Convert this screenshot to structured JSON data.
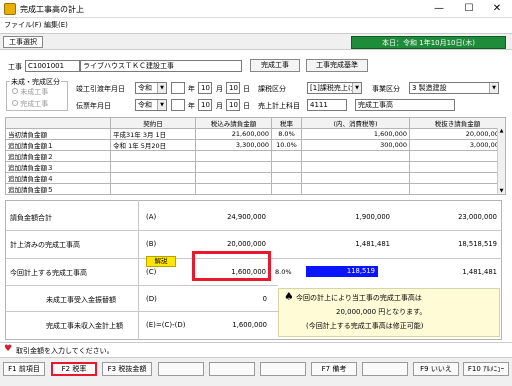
{
  "window": {
    "title": "完成工事高の計上",
    "min_glyph": "—",
    "max_glyph": "☐",
    "close_glyph": "✕"
  },
  "menu": {
    "file": "ファイル(F)",
    "edit": "編集(E)"
  },
  "toolbar": {
    "tab_label": "工事選択",
    "date_text": "本日：令和 1年10月10日(木)"
  },
  "form": {
    "koji_label": "工事",
    "koji_code": "C1001001",
    "koji_name": "ライブハウスＴＫＣ建設工事",
    "kanseikoji_btn": "完成工事",
    "kanseikoji_kijun_btn": "工事完成基準",
    "kubun_title": "未成・完成区分",
    "mikansei_label": "未成工事",
    "kansei_label": "完成工事",
    "kanseibi_label": "竣工引渡年月日",
    "era": "令和",
    "year": "",
    "year_unit": "年",
    "month": "10",
    "month_unit": "月",
    "day": "10",
    "day_unit": "日",
    "kazei_label": "課税区分",
    "kazei_value": "[1]課税売上げ",
    "jigyo_label": "事業区分",
    "jigyo_value": "3 製造建設",
    "denpyo_label": "伝票年月日",
    "era2": "令和",
    "year2": "",
    "month2": "10",
    "day2": "10",
    "uriage_label": "売上計上科目",
    "uriage_code": "4111",
    "uriage_name": "完成工事高"
  },
  "grid": {
    "headers": [
      "",
      "契約日",
      "税込み請負金額",
      "税率",
      "(内、消費税等)",
      "税抜き請負金額"
    ],
    "rows": [
      [
        "当初請負金額",
        "平成31年 3月 1日",
        "21,600,000",
        "8.0%",
        "1,600,000",
        "20,000,000"
      ],
      [
        "追加請負金額１",
        "令和 1年 5月20日",
        "3,300,000",
        "10.0%",
        "300,000",
        "3,000,000"
      ],
      [
        "追加請負金額２",
        "",
        "",
        "",
        "",
        ""
      ],
      [
        "追加請負金額３",
        "",
        "",
        "",
        "",
        ""
      ],
      [
        "追加請負金額４",
        "",
        "",
        "",
        "",
        ""
      ],
      [
        "追加請負金額５",
        "",
        "",
        "",
        "",
        ""
      ]
    ]
  },
  "summary": {
    "total_label": "請負金額合計",
    "total_key": "(A)",
    "total_incl": "24,900,000",
    "total_tax": "1,900,000",
    "total_excl": "23,000,000",
    "done_label": "計上済みの完成工事高",
    "done_key": "(B)",
    "done_incl": "20,000,000",
    "done_tax": "1,481,481",
    "done_excl": "18,518,519",
    "kaisetsu": "解説",
    "current_label": "今回計上する完成工事高",
    "current_key": "(C)",
    "current_incl": "1,600,000",
    "current_rate": "8.0%",
    "current_tax": "118,519",
    "current_excl": "1,481,481",
    "advance_label": "未成工事受入金振替額",
    "advance_key": "(D)",
    "advance_value": "0",
    "receivable_label": "完成工事未収入金計上額",
    "receivable_key": "(E)=(C)-(D)",
    "receivable_value": "1,600,000",
    "note_line1": "今回の計上により当工事の完成工事高は",
    "note_line2": "20,000,000 円となります。",
    "note_line3": "(今回計上する完成工事高は修正可能)",
    "note_icon": "♠"
  },
  "status": {
    "icon": "♥",
    "text": "取引金額を入力してください。"
  },
  "fkeys": [
    {
      "label": "F1 前項目"
    },
    {
      "label": "F2 税率"
    },
    {
      "label": "F3 税抜金額"
    },
    {
      "label": "F7 備考"
    },
    {
      "label": "F9 いいえ"
    },
    {
      "label": "F10 ｱﾙﾒﾆｭｰ"
    }
  ],
  "colors": {
    "accent_green": "#1e8c3a",
    "highlight_red": "#e8192c",
    "selection_blue": "#0a14ff"
  }
}
